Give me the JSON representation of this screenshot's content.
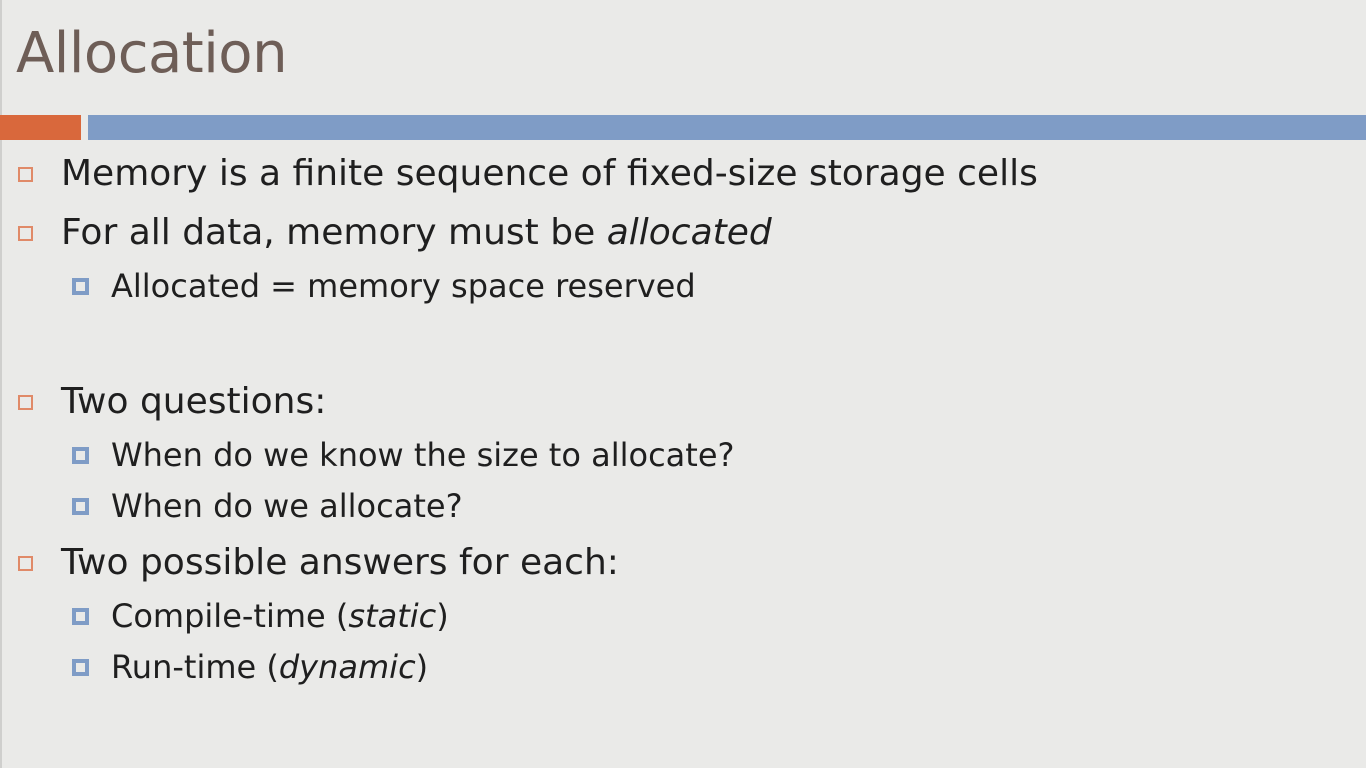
{
  "slide": {
    "title": "Allocation",
    "colors": {
      "title": "#6e5e57",
      "accent_orange": "#d9683c",
      "accent_blue": "#7f9cc6",
      "background": "#eaeae8"
    },
    "bullets": [
      {
        "level": 1,
        "text": "Memory is a finite sequence of fixed-size storage cells"
      },
      {
        "level": 1,
        "text_prefix": "For all data, memory must be ",
        "text_italic": "allocated"
      },
      {
        "level": 2,
        "text": "Allocated = memory space reserved"
      },
      {
        "level": 1,
        "text": "Two questions:"
      },
      {
        "level": 2,
        "text": "When do we know the size to allocate?"
      },
      {
        "level": 2,
        "text": "When do we allocate?"
      },
      {
        "level": 1,
        "text": "Two possible answers for each:"
      },
      {
        "level": 2,
        "text_prefix": "Compile-time (",
        "text_italic": "static",
        "text_suffix": ")"
      },
      {
        "level": 2,
        "text_prefix": "Run-time (",
        "text_italic": "dynamic",
        "text_suffix": ")"
      }
    ],
    "icons": {
      "level1_bullet": "hollow-square-bullet-icon",
      "level2_bullet": "framed-square-bullet-icon"
    }
  }
}
